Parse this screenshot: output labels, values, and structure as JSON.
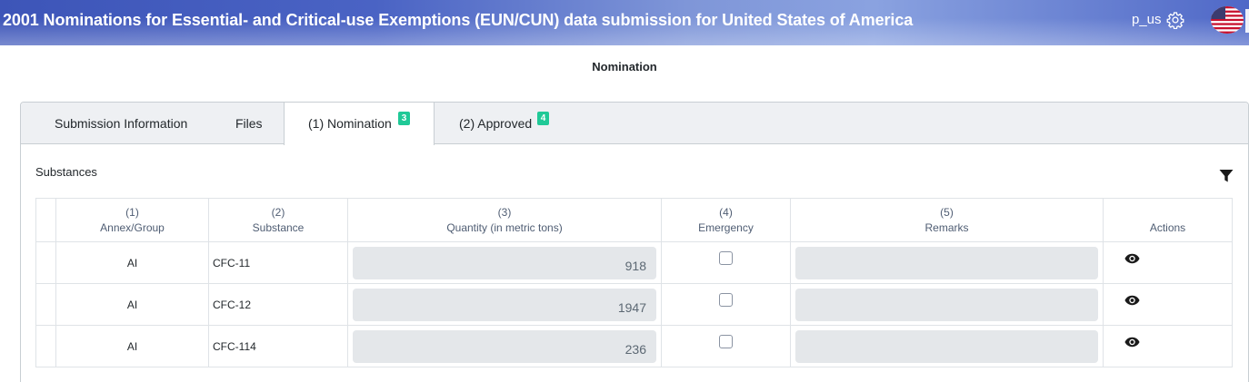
{
  "header": {
    "title": "2001 Nominations for Essential- and Critical-use Exemptions (EUN/CUN) data submission for United States of America",
    "user": "p_us",
    "settings_icon": "gear-icon",
    "flag_icon": "us-flag-icon"
  },
  "page_heading": "Nomination",
  "tabs": [
    {
      "label": "Submission Information"
    },
    {
      "label": "Files"
    },
    {
      "label": "(1) Nomination",
      "badge": "3",
      "active": true
    },
    {
      "label": "(2) Approved",
      "badge": "4"
    }
  ],
  "badge_color": "#20c997",
  "section": {
    "label": "Substances",
    "filter_icon": "filter-icon"
  },
  "table": {
    "columns": [
      {
        "num": "(1)",
        "label": "Annex/Group"
      },
      {
        "num": "(2)",
        "label": "Substance"
      },
      {
        "num": "(3)",
        "label": "Quantity (in metric tons)"
      },
      {
        "num": "(4)",
        "label": "Emergency"
      },
      {
        "num": "(5)",
        "label": "Remarks"
      },
      {
        "num": "",
        "label": "Actions"
      }
    ],
    "rows": [
      {
        "annex": "AI",
        "substance": "CFC-11",
        "quantity": "918",
        "emergency": false,
        "remarks": ""
      },
      {
        "annex": "AI",
        "substance": "CFC-12",
        "quantity": "1947",
        "emergency": false,
        "remarks": ""
      },
      {
        "annex": "AI",
        "substance": "CFC-114",
        "quantity": "236",
        "emergency": false,
        "remarks": ""
      }
    ],
    "action_icon": "eye-icon"
  }
}
